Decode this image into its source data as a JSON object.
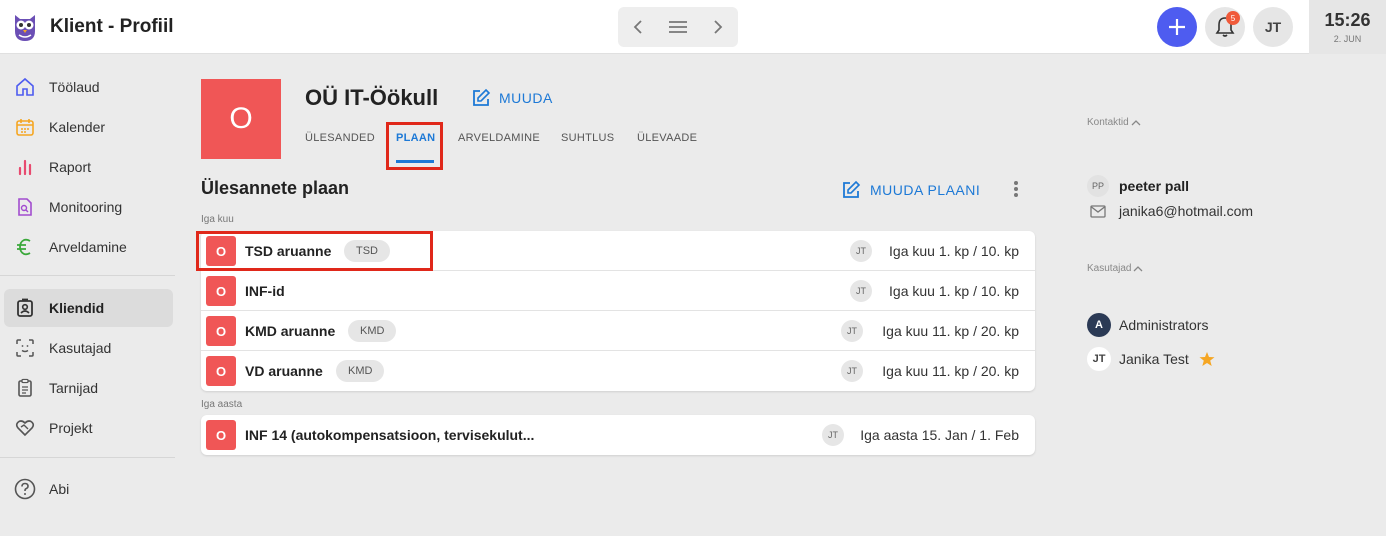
{
  "header": {
    "title": "Klient - Profiil",
    "notifications_count": "5",
    "user_initials": "JT",
    "time": "15:26",
    "date": "2. JUN"
  },
  "sidebar": {
    "items": [
      {
        "label": "Töölaud",
        "icon": "home-icon"
      },
      {
        "label": "Kalender",
        "icon": "calendar-icon"
      },
      {
        "label": "Raport",
        "icon": "bar-chart-icon"
      },
      {
        "label": "Monitooring",
        "icon": "document-search-icon"
      },
      {
        "label": "Arveldamine",
        "icon": "euro-icon"
      },
      {
        "label": "Kliendid",
        "icon": "client-badge-icon",
        "active": true
      },
      {
        "label": "Kasutajad",
        "icon": "face-scan-icon"
      },
      {
        "label": "Tarnijad",
        "icon": "clipboard-icon"
      },
      {
        "label": "Projekt",
        "icon": "heart-handshake-icon"
      },
      {
        "label": "Abi",
        "icon": "help-icon"
      }
    ]
  },
  "client": {
    "avatar_letter": "O",
    "name": "OÜ IT-Öökull",
    "edit_label": "MUUDA",
    "tabs": [
      "ÜLESANDED",
      "PLAAN",
      "ARVELDAMINE",
      "SUHTLUS",
      "ÜLEVAADE"
    ],
    "active_tab": "PLAAN"
  },
  "plan": {
    "title": "Ülesannete plaan",
    "edit_label": "MUUDA PLAANI",
    "groups": [
      {
        "label": "Iga kuu",
        "rows": [
          {
            "letter": "O",
            "name": "TSD aruanne",
            "tag": "TSD",
            "assignee": "JT",
            "schedule": "Iga kuu 1. kp / 10. kp"
          },
          {
            "letter": "O",
            "name": "INF-id",
            "tag": "",
            "assignee": "JT",
            "schedule": "Iga kuu 1. kp / 10. kp"
          },
          {
            "letter": "O",
            "name": "KMD aruanne",
            "tag": "KMD",
            "assignee": "JT",
            "schedule": "Iga kuu 11. kp / 20. kp"
          },
          {
            "letter": "O",
            "name": "VD aruanne",
            "tag": "KMD",
            "assignee": "JT",
            "schedule": "Iga kuu 11. kp / 20. kp"
          }
        ]
      },
      {
        "label": "Iga aasta",
        "rows": [
          {
            "letter": "O",
            "name": "INF 14 (autokompensatsioon, tervisekulut...",
            "tag": "",
            "assignee": "JT",
            "schedule": "Iga aasta 15. Jan / 1. Feb"
          }
        ]
      }
    ]
  },
  "right_panel": {
    "contacts_label": "Kontaktid",
    "contact": {
      "initials": "PP",
      "name": "peeter pall",
      "email": "janika6@hotmail.com"
    },
    "users_label": "Kasutajad",
    "users": [
      {
        "initials": "A",
        "name": "Administrators"
      },
      {
        "initials": "JT",
        "name": "Janika Test",
        "starred": true
      }
    ]
  },
  "colors": {
    "accent": "#1d79d6",
    "client_red": "#f05656",
    "add_button": "#4e5cf0",
    "highlight": "#e0281a",
    "star": "#f5a623"
  }
}
